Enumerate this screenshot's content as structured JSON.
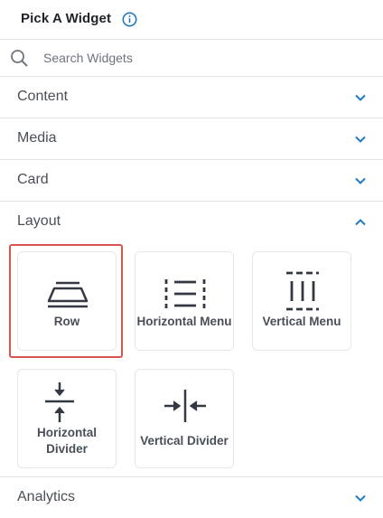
{
  "header": {
    "title": "Pick A Widget",
    "info_icon": "info-circle-icon"
  },
  "search": {
    "placeholder": "Search Widgets",
    "value": "",
    "icon": "search-icon"
  },
  "sections": {
    "content": {
      "label": "Content",
      "expanded": false
    },
    "media": {
      "label": "Media",
      "expanded": false
    },
    "card": {
      "label": "Card",
      "expanded": false
    },
    "layout": {
      "label": "Layout",
      "expanded": true,
      "widgets": [
        {
          "label": "Row",
          "icon": "row-icon",
          "selected": true
        },
        {
          "label": "Horizontal Menu",
          "icon": "horizontal-menu-icon",
          "selected": false
        },
        {
          "label": "Vertical Menu",
          "icon": "vertical-menu-icon",
          "selected": false
        },
        {
          "label_line1": "Horizontal",
          "label_line2": "Divider",
          "icon": "horizontal-divider-icon",
          "selected": false
        },
        {
          "label": "Vertical Divider",
          "icon": "vertical-divider-icon",
          "selected": false
        }
      ]
    },
    "analytics": {
      "label": "Analytics",
      "expanded": false
    }
  },
  "colors": {
    "accent": "#1f7ac4",
    "selected_border": "#d9534f",
    "icon": "#333842"
  }
}
